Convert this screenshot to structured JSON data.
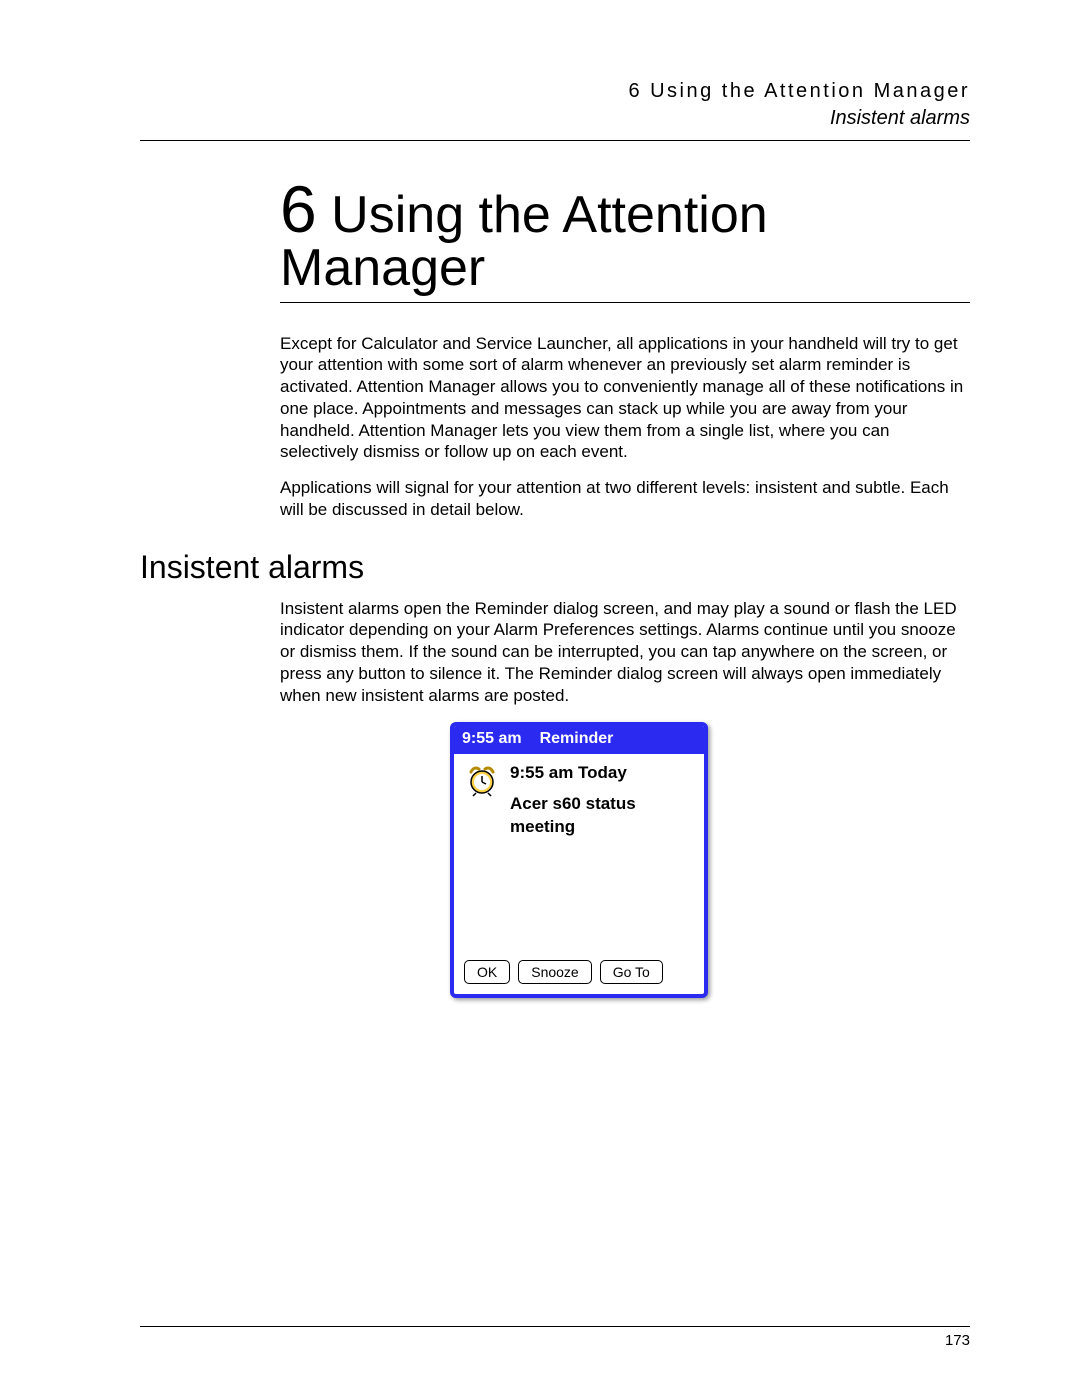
{
  "header": {
    "chapter_label": "6 Using the Attention Manager",
    "section_label": "Insistent alarms"
  },
  "chapter": {
    "number": "6",
    "title_line1": " Using the Attention",
    "title_line2": "Manager"
  },
  "body": {
    "intro_p1": "Except for Calculator and Service Launcher, all applications in your handheld will try to get your attention with some sort of alarm whenever an previously set alarm reminder is activated. Attention Manager allows you to conveniently manage all of these notifications in one place. Appointments and messages can stack up while you are away from your handheld. Attention Manager lets you view them from a single list, where you can selectively dismiss or follow up on each event.",
    "intro_p2": "Applications will signal for your attention at two different levels: insistent and subtle. Each will be discussed in detail below."
  },
  "section": {
    "heading": "Insistent alarms",
    "p1": "Insistent alarms open the Reminder dialog screen, and may play a sound or flash the LED indicator depending on your Alarm Preferences settings. Alarms continue until you snooze or dismiss them. If the sound can be interrupted, you can tap anywhere on the screen, or press any button to silence it. The Reminder dialog screen will always open immediately when new insistent alarms are posted."
  },
  "reminder": {
    "time": "9:55 am",
    "title": "Reminder",
    "event_time": "9:55 am Today",
    "event_line1": "Acer s60 status",
    "event_line2": "meeting",
    "buttons": {
      "ok": "OK",
      "snooze": "Snooze",
      "goto": "Go To"
    }
  },
  "footer": {
    "page_number": "173"
  }
}
